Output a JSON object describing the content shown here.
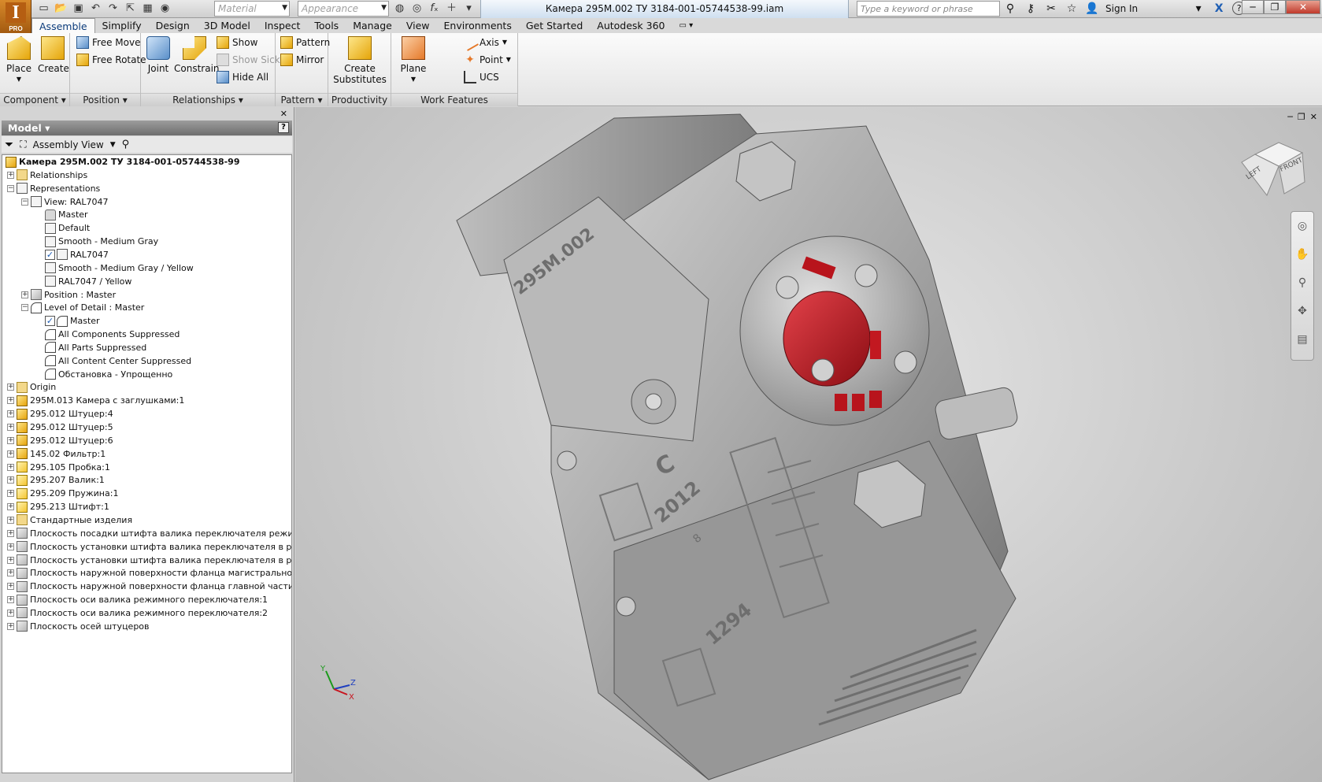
{
  "app": {
    "logo_letter": "I",
    "edition": "PRO"
  },
  "quick_access": {
    "material_placeholder": "Material",
    "appearance_placeholder": "Appearance"
  },
  "window": {
    "title": "Камера 295М.002 ТУ 3184-001-05744538-99.iam"
  },
  "search": {
    "placeholder": "Type a keyword or phrase"
  },
  "account": {
    "sign_in": "Sign In",
    "exchange": "X",
    "help": "?"
  },
  "tabs": [
    "Assemble",
    "Simplify",
    "Design",
    "3D Model",
    "Inspect",
    "Tools",
    "Manage",
    "View",
    "Environments",
    "Get Started",
    "Autodesk 360"
  ],
  "active_tab": "Assemble",
  "ribbon": {
    "component": {
      "title": "Component",
      "place": "Place",
      "create": "Create"
    },
    "position": {
      "title": "Position",
      "free_move": "Free Move",
      "free_rotate": "Free Rotate"
    },
    "relationships": {
      "title": "Relationships",
      "joint": "Joint",
      "constrain": "Constrain",
      "show": "Show",
      "show_sick": "Show Sick",
      "hide_all": "Hide All"
    },
    "pattern": {
      "title": "Pattern",
      "pattern": "Pattern",
      "mirror": "Mirror"
    },
    "productivity": {
      "title": "Productivity",
      "create_substitutes_1": "Create",
      "create_substitutes_2": "Substitutes"
    },
    "work_features": {
      "title": "Work Features",
      "plane": "Plane",
      "axis": "Axis",
      "point": "Point",
      "ucs": "UCS"
    }
  },
  "browser": {
    "title": "Model",
    "help": "?",
    "view_mode": "Assembly View",
    "tree": [
      {
        "label": "Камера 295М.002 ТУ 3184-001-05744538-99",
        "bold": true
      },
      {
        "label": "Relationships"
      },
      {
        "label": "Representations"
      },
      {
        "label": "View: RAL7047"
      },
      {
        "label": "Master"
      },
      {
        "label": "Default"
      },
      {
        "label": "Smooth - Medium Gray"
      },
      {
        "label": "RAL7047"
      },
      {
        "label": "Smooth - Medium Gray / Yellow"
      },
      {
        "label": "RAL7047 / Yellow"
      },
      {
        "label": "Position : Master"
      },
      {
        "label": "Level of Detail : Master"
      },
      {
        "label": "Master"
      },
      {
        "label": "All Components Suppressed"
      },
      {
        "label": "All Parts Suppressed"
      },
      {
        "label": "All Content Center Suppressed"
      },
      {
        "label": "Обстановка - Упрощенно"
      },
      {
        "label": "Origin"
      },
      {
        "label": "295М.013 Камера с заглушками:1"
      },
      {
        "label": "295.012 Штуцер:4"
      },
      {
        "label": "295.012 Штуцер:5"
      },
      {
        "label": "295.012 Штуцер:6"
      },
      {
        "label": "145.02 Фильтр:1"
      },
      {
        "label": "295.105 Пробка:1"
      },
      {
        "label": "295.207 Валик:1"
      },
      {
        "label": "295.209 Пружина:1"
      },
      {
        "label": "295.213 Штифт:1"
      },
      {
        "label": "Стандартные изделия"
      },
      {
        "label": "Плоскость посадки штифта валика переключателя режимов"
      },
      {
        "label": "Плоскость установки штифта валика переключателя в режиме ПГ"
      },
      {
        "label": "Плоскость установки штифта валика переключателя в режиме С"
      },
      {
        "label": "Плоскость наружной поверхности фланца магистральной части"
      },
      {
        "label": "Плоскость наружной поверхности фланца главной части"
      },
      {
        "label": "Плоскость оси валика режимного переключателя:1"
      },
      {
        "label": "Плоскость оси валика режимного переключателя:2"
      },
      {
        "label": "Плоскость осей штуцеров"
      }
    ]
  },
  "viewcube": {
    "left": "LEFT",
    "front": "FRONT"
  },
  "model_markings": {
    "part_no": "295М.002",
    "year": "2012",
    "serial": "1294",
    "digit": "8",
    "mode_c": "С"
  },
  "triad": {
    "x": "X",
    "y": "Y",
    "z": "Z"
  },
  "colors": {
    "accent": "#1f5fb4",
    "highlight_red": "#c8141e",
    "model_gray": "#9a9a9a"
  }
}
